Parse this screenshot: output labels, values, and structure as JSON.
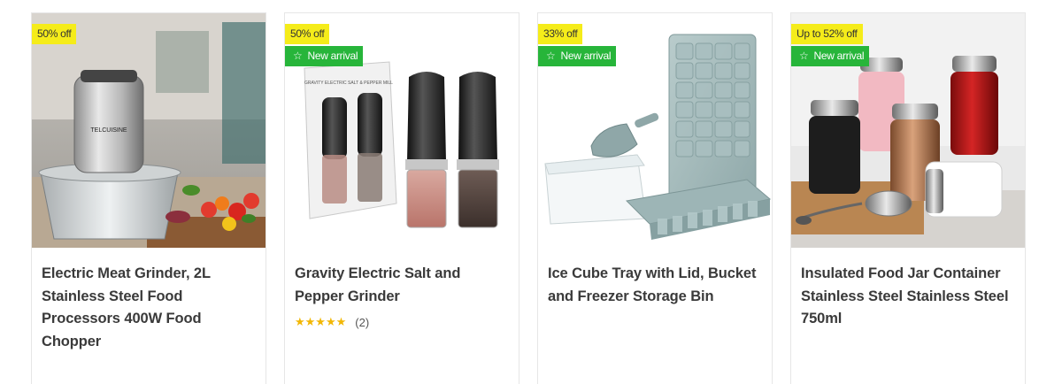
{
  "products": [
    {
      "sale_badge": "50% off",
      "title": "Electric Meat Grinder, 2L Stainless Steel Food Processors 400W Food Chopper",
      "brand_label": "TELCUISINE"
    },
    {
      "sale_badge": "50% off",
      "new_badge": "New arrival",
      "title": "Gravity Electric Salt and Pepper Grinder",
      "box_label": "GRAVITY ELECTRIC SALT & PEPPER MILL",
      "rating_stars": "★★★★★",
      "rating_value": 5,
      "review_count": "(2)"
    },
    {
      "sale_badge": "33% off",
      "new_badge": "New arrival",
      "title": "Ice Cube Tray with Lid, Bucket and Freezer Storage Bin"
    },
    {
      "sale_badge": "Up to 52% off",
      "new_badge": "New arrival",
      "title": "Insulated Food Jar Container Stainless Steel Stainless Steel 750ml"
    }
  ],
  "icons": {
    "new_badge_icon": "star-outline-icon",
    "rating_icon": "star-icon"
  },
  "colors": {
    "sale_badge": "#f5ec1a",
    "new_badge": "#27b53a",
    "rating_star": "#f2b705"
  }
}
